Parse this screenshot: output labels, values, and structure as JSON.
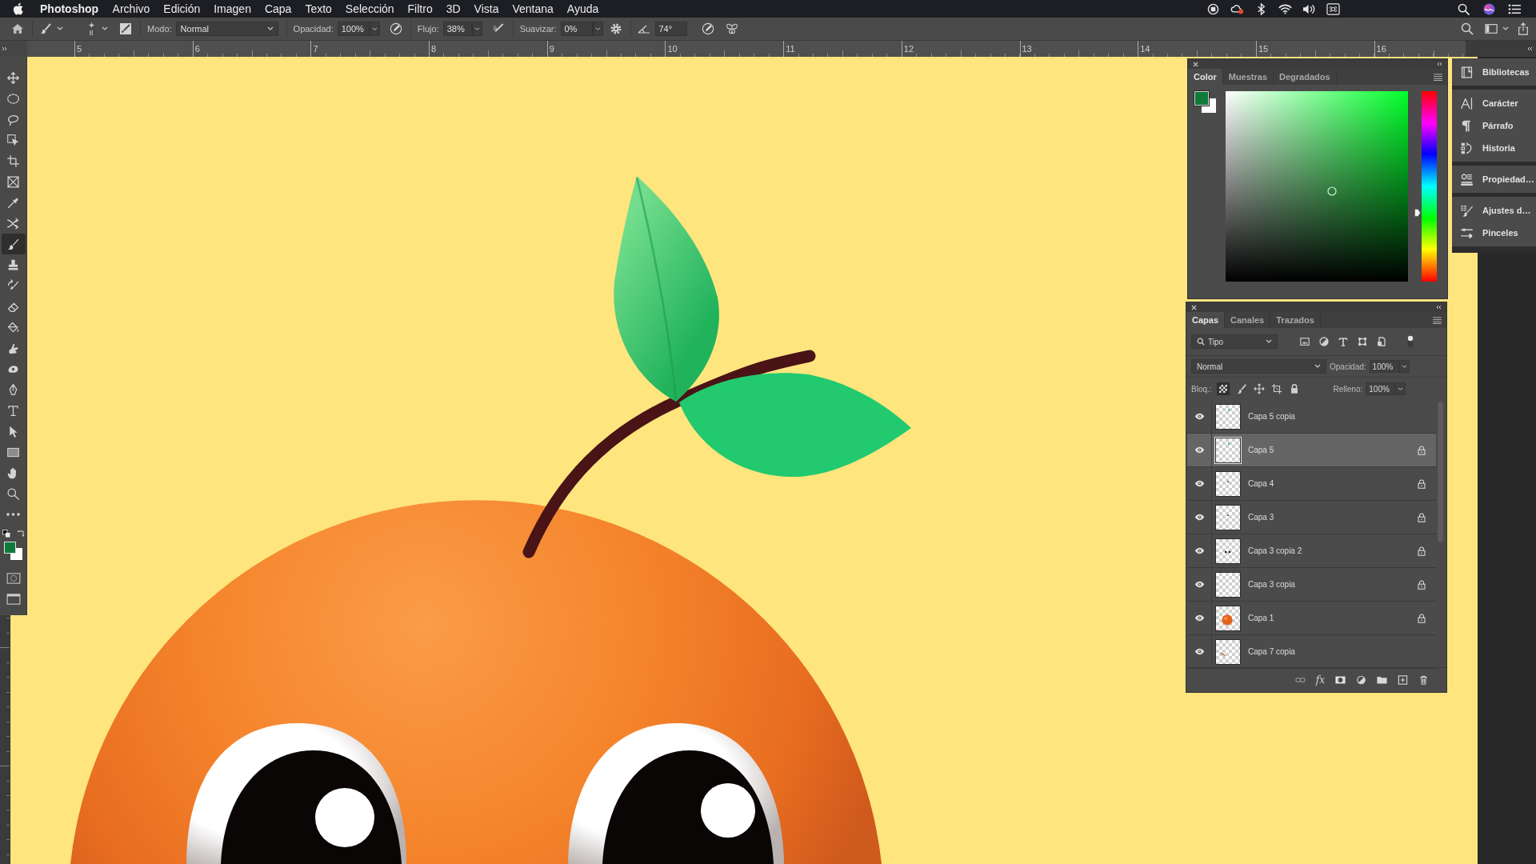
{
  "menu_bar": {
    "app_name": "Photoshop",
    "menus": [
      "Archivo",
      "Edición",
      "Imagen",
      "Capa",
      "Texto",
      "Selección",
      "Filtro",
      "3D",
      "Vista",
      "Ventana",
      "Ayuda"
    ]
  },
  "options_bar": {
    "brush_size": "8",
    "mode_label": "Modo:",
    "mode": "Normal",
    "opacity_label": "Opacidad:",
    "opacity": "100%",
    "flow_label": "Flujo:",
    "flow": "38%",
    "smoothing_label": "Suavizar:",
    "smoothing": "0%",
    "angle": "74°"
  },
  "ruler": {
    "labels": [
      "5",
      "6",
      "7",
      "8",
      "9",
      "10",
      "11",
      "12",
      "13",
      "14",
      "15",
      "16"
    ]
  },
  "tools": [
    {
      "kind": "move",
      "selected": false
    },
    {
      "kind": "marquee",
      "selected": false
    },
    {
      "kind": "lasso",
      "selected": false
    },
    {
      "kind": "objectselect",
      "selected": false
    },
    {
      "kind": "crop",
      "selected": false
    },
    {
      "kind": "frame",
      "selected": false
    },
    {
      "kind": "eyedropper",
      "selected": false
    },
    {
      "kind": "patch",
      "selected": false
    },
    {
      "kind": "brush",
      "selected": true
    },
    {
      "kind": "stamp",
      "selected": false
    },
    {
      "kind": "historybrush",
      "selected": false
    },
    {
      "kind": "eraser",
      "selected": false
    },
    {
      "kind": "bucket",
      "selected": false
    },
    {
      "kind": "smudge",
      "selected": false
    },
    {
      "kind": "sponge",
      "selected": false
    },
    {
      "kind": "pen",
      "selected": false
    },
    {
      "kind": "type",
      "selected": false
    },
    {
      "kind": "pathselect",
      "selected": false
    },
    {
      "kind": "rectangle",
      "selected": false
    },
    {
      "kind": "hand",
      "selected": false
    },
    {
      "kind": "zoom",
      "selected": false
    },
    {
      "kind": "more",
      "selected": false
    }
  ],
  "color_panel": {
    "tabs": [
      {
        "label": "Color",
        "selected": true
      },
      {
        "label": "Muestras",
        "selected": false
      },
      {
        "label": "Degradados",
        "selected": false
      }
    ],
    "hue_slider": {
      "level": 0.36
    }
  },
  "dock": {
    "groups": [
      {
        "items": [
          {
            "kind": "libraries",
            "label": "Bibliotecas"
          }
        ]
      },
      {
        "items": [
          {
            "kind": "character",
            "label": "Carácter"
          },
          {
            "kind": "paragraph",
            "label": "Párrafo"
          },
          {
            "kind": "history",
            "label": "Historia"
          }
        ]
      },
      {
        "items": [
          {
            "kind": "properties",
            "label": "Propiedad…"
          }
        ]
      },
      {
        "items": [
          {
            "kind": "brushsettings",
            "label": "Ajustes d…"
          },
          {
            "kind": "brushes",
            "label": "Pinceles"
          }
        ]
      }
    ]
  },
  "layers_panel": {
    "tabs": [
      {
        "label": "Capas",
        "selected": true
      },
      {
        "label": "Canales",
        "selected": false
      },
      {
        "label": "Trazados",
        "selected": false
      }
    ],
    "filter": "Tipo",
    "blend_mode": "Normal",
    "opacity_label": "Opacidad:",
    "opacity": "100%",
    "lock_label": "Bloq.:",
    "fill_label": "Relleno:",
    "fill": "100%",
    "effects_label": "fx",
    "layers": [
      {
        "name": "Capa 5 copia",
        "kind": "leaf",
        "visible": true,
        "locked": false,
        "selected": false
      },
      {
        "name": "Capa 5",
        "kind": "leaf",
        "visible": true,
        "locked": true,
        "selected": true
      },
      {
        "name": "Capa 4",
        "kind": "dot",
        "visible": true,
        "locked": true,
        "selected": false
      },
      {
        "name": "Capa 3",
        "kind": "dot",
        "visible": true,
        "locked": true,
        "selected": false
      },
      {
        "name": "Capa 3 copia 2",
        "kind": "eyes",
        "visible": true,
        "locked": true,
        "selected": false
      },
      {
        "name": "Capa 3 copia",
        "kind": "highlight",
        "visible": true,
        "locked": true,
        "selected": false
      },
      {
        "name": "Capa 1",
        "kind": "orange",
        "visible": true,
        "locked": true,
        "selected": false
      },
      {
        "name": "Capa 7 copia",
        "kind": "stem",
        "visible": true,
        "locked": false,
        "selected": false
      }
    ]
  }
}
